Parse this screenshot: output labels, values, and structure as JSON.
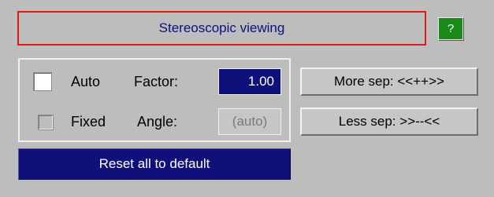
{
  "header": {
    "title": "Stereoscopic viewing",
    "help_label": "?"
  },
  "options": {
    "auto": {
      "label": "Auto",
      "checked": false,
      "enabled": true
    },
    "fixed": {
      "label": "Fixed",
      "checked": false,
      "enabled": true
    },
    "factor": {
      "label": "Factor:",
      "value": "1.00"
    },
    "angle": {
      "label": "Angle:",
      "value": "(auto)",
      "disabled": true
    }
  },
  "buttons": {
    "more_sep": "More sep: <<++>>",
    "less_sep": "Less sep: >>--<<",
    "reset": "Reset all to default"
  },
  "colors": {
    "background": "#bdbdbd",
    "accent_navy": "#10107a",
    "help_green": "#1a8a1a",
    "title_border_red": "#e01818",
    "disabled_text": "#7a7a7a"
  }
}
